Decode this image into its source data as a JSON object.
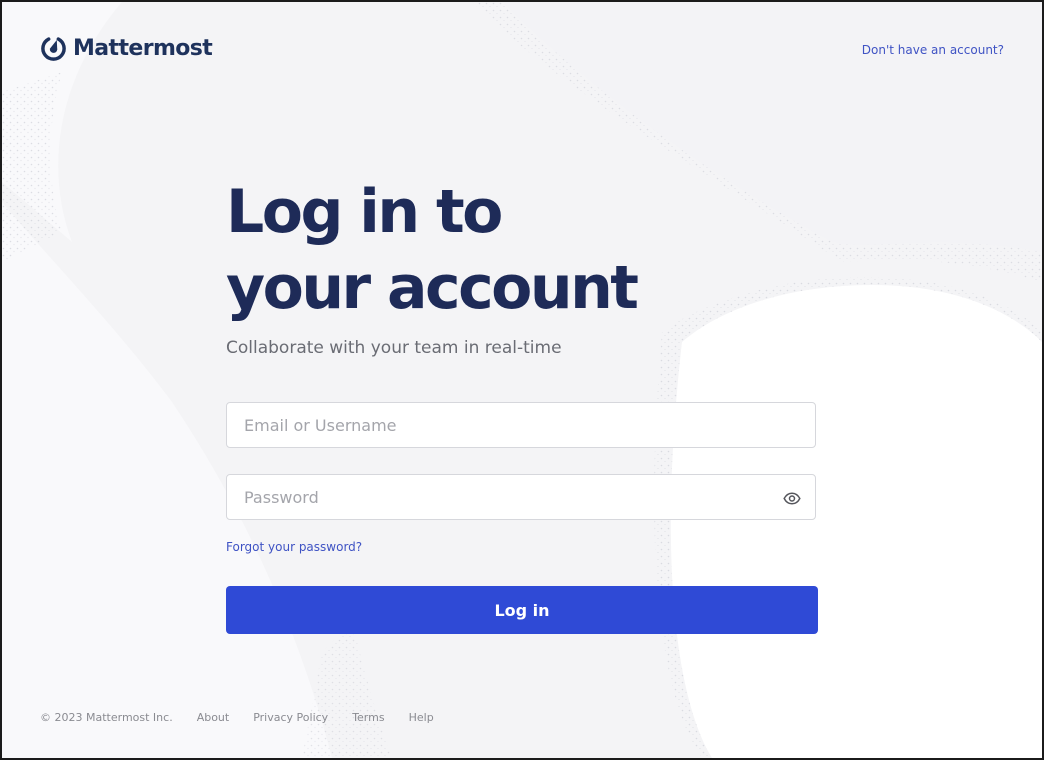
{
  "header": {
    "brand_name": "Mattermost",
    "signup_link": "Don't have an account?"
  },
  "main": {
    "title_line1": "Log in to",
    "title_line2": "your account",
    "subtitle": "Collaborate with your team in real-time",
    "email_placeholder": "Email or Username",
    "email_value": "",
    "password_placeholder": "Password",
    "password_value": "",
    "forgot_password": "Forgot your password?",
    "login_button": "Log in"
  },
  "footer": {
    "copyright": "© 2023 Mattermost Inc.",
    "links": [
      "About",
      "Privacy Policy",
      "Terms",
      "Help"
    ]
  },
  "icons": {
    "logo": "mattermost-logo-icon",
    "password_toggle": "eye-icon"
  },
  "colors": {
    "brand_navy": "#1e325c",
    "link": "#3f53c4",
    "button": "#2f4ad6",
    "background": "#f4f4f6"
  }
}
